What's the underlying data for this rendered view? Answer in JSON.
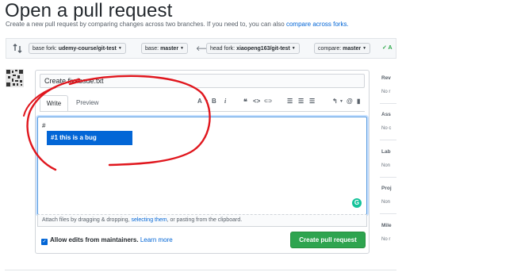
{
  "header": {
    "title": "Open a pull request",
    "subtitle_before": "Create a new pull request by comparing changes across two branches. If you need to, you can also ",
    "subtitle_link": "compare across forks."
  },
  "compare_bar": {
    "base_fork_label": "base fork: ",
    "base_fork_value": "udemy-course/git-test",
    "base_label": "base: ",
    "base_value": "master",
    "head_fork_label": "head fork: ",
    "head_fork_value": "xiaopeng163/git-test",
    "compare_label": "compare: ",
    "compare_value": "master",
    "status_text": "✓ A"
  },
  "form": {
    "title_value": "Create fix-issue.txt",
    "tabs": [
      "Write",
      "Preview"
    ],
    "comment_text": "#",
    "autocomplete_item": "#1 this is a bug",
    "attach_before": "Attach files by dragging & dropping, ",
    "attach_link": "selecting them",
    "attach_after": ", or pasting from the clipboard.",
    "allow_edits_label": "Allow edits from maintainers.",
    "learn_more": "Learn more",
    "submit_label": "Create pull request"
  },
  "toolbar": {
    "heading": "A",
    "bold": "B",
    "italic": "i",
    "quote": "❝",
    "code": "<>",
    "link": "⊂⊃",
    "ul": "☰",
    "ol": "☰",
    "task": "☰",
    "reply": "↰",
    "mention": "@",
    "saved": "▮"
  },
  "sidebar": [
    {
      "heading": "Rev",
      "value": "No r"
    },
    {
      "heading": "Ass",
      "value": "No c"
    },
    {
      "heading": "Lab",
      "value": "Non"
    },
    {
      "heading": "Proj",
      "value": "Non"
    },
    {
      "heading": "Mile",
      "value": "No r"
    }
  ],
  "colors": {
    "accent": "#0366d6",
    "submit": "#2ea44f",
    "annotation": "#e0161d",
    "grammarly": "#15c39a"
  }
}
